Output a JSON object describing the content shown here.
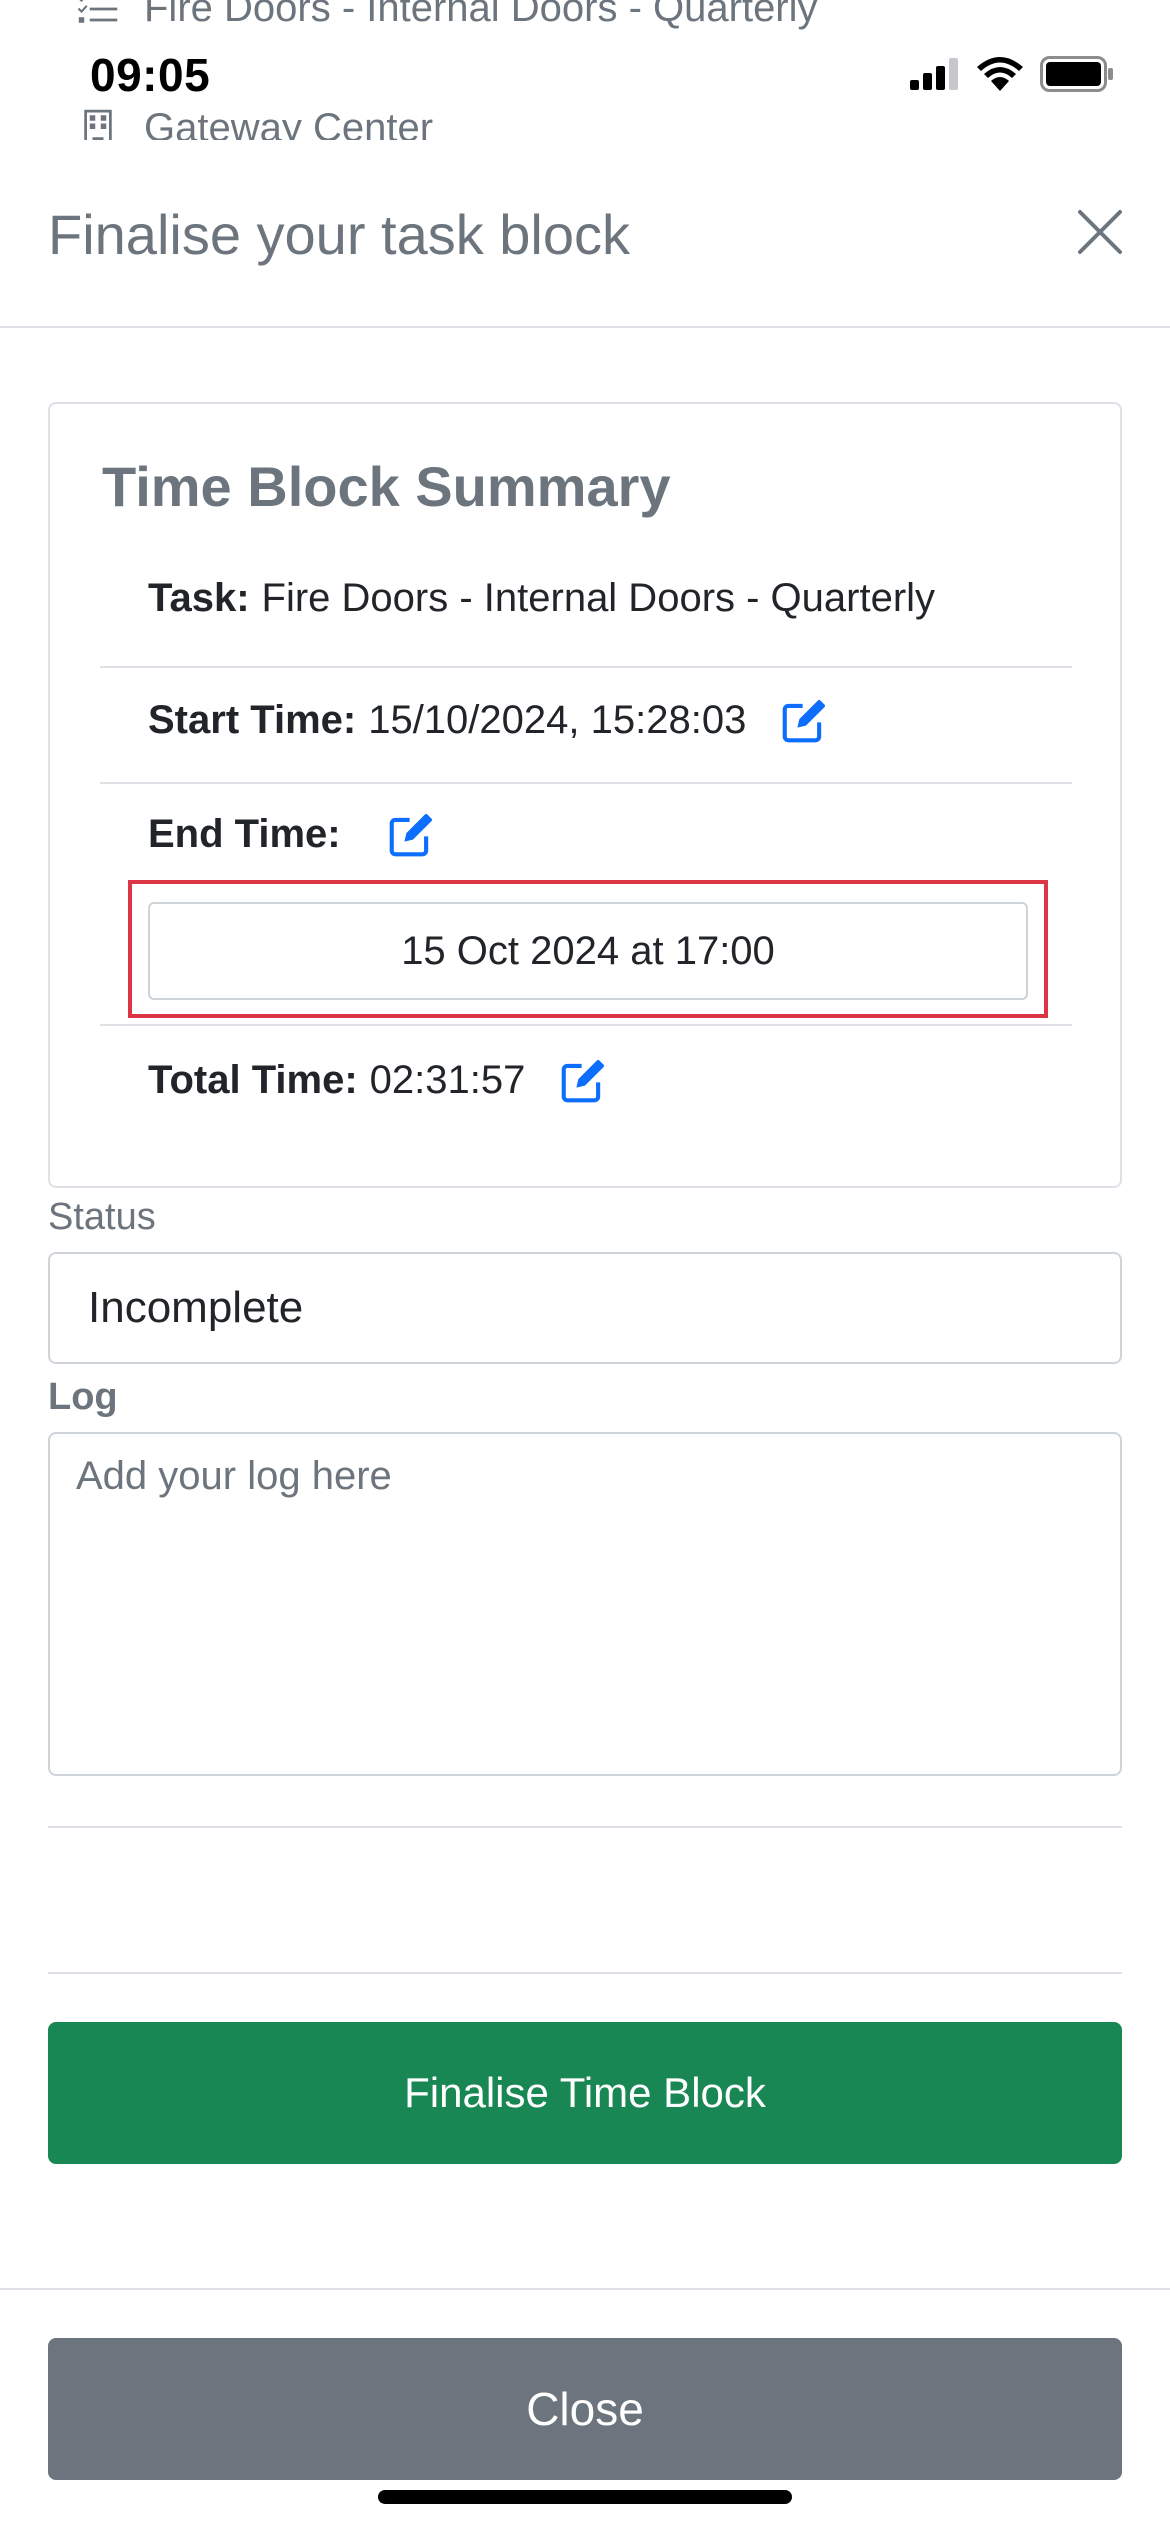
{
  "background_page": {
    "task_row_text": "Fire Doors - Internal Doors - Quarterly",
    "location_row_text": "Gateway Center"
  },
  "status_bar": {
    "time": "09:05"
  },
  "modal": {
    "title": "Finalise your task block",
    "summary": {
      "title": "Time Block Summary",
      "task_label": "Task:",
      "task_value": "Fire Doors - Internal Doors - Quarterly",
      "start_label": "Start Time:",
      "start_value": "15/10/2024, 15:28:03",
      "end_label": "End Time:",
      "end_picker_value": "15 Oct 2024 at 17:00",
      "total_label": "Total Time:",
      "total_value": "02:31:57"
    },
    "status": {
      "label": "Status",
      "value": "Incomplete"
    },
    "log": {
      "label": "Log",
      "placeholder": "Add your log here"
    },
    "finalise_button": "Finalise Time Block",
    "close_button": "Close"
  },
  "colors": {
    "primary_blue": "#0d6efd",
    "success_green": "#198754",
    "secondary_gray": "#6c757d",
    "highlight_red": "#dc3545"
  },
  "icons": {
    "task_list": "checklist-icon",
    "location": "building-icon",
    "edit": "pencil-square-icon",
    "close": "close-icon"
  }
}
